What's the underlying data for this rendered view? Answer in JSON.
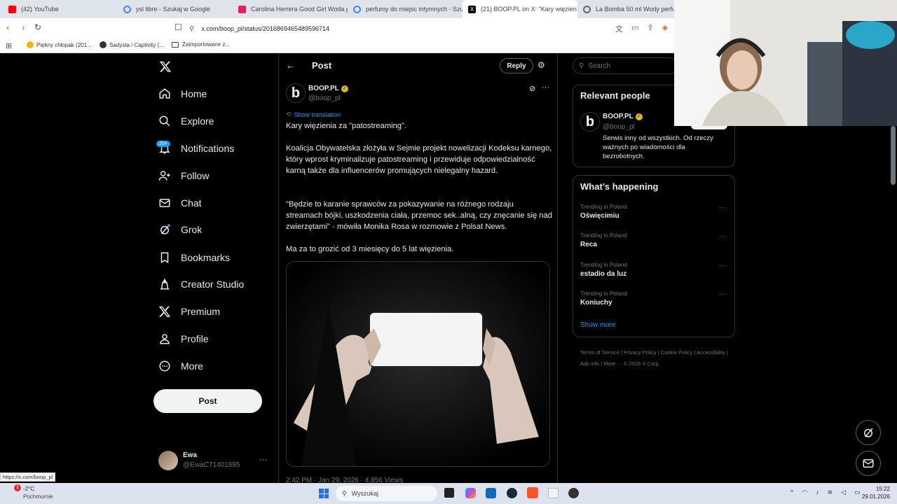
{
  "browser": {
    "tabs": [
      {
        "title": "(42) YouTube",
        "color": "#ff0000"
      },
      {
        "title": "ysl libre - Szukaj w Google",
        "color": "#4285f4"
      },
      {
        "title": "Carolina Herrera Good Girl Woda pe",
        "color": "#e0245e"
      },
      {
        "title": "perfumy do miejsc intymnych - Szuk",
        "color": "#4285f4"
      },
      {
        "title": "(21) BOOP.PL on X: \"Kary więzien",
        "color": "#000000",
        "active": true
      },
      {
        "title": "La Bomba 50 ml Wody perfumow",
        "color": "#666666"
      }
    ],
    "close": "×",
    "url": "x.com/boop_pl/status/2016869465489596714",
    "bookmarks": [
      "Piękny chłopak (201...",
      "Sadysta / Captivity (...",
      "Zaimportowane z..."
    ],
    "status_url": "https://x.com/boop_pl"
  },
  "sidebar": {
    "items": [
      {
        "label": "Home"
      },
      {
        "label": "Explore"
      },
      {
        "label": "Notifications",
        "badge": "20+"
      },
      {
        "label": "Follow"
      },
      {
        "label": "Chat"
      },
      {
        "label": "Grok"
      },
      {
        "label": "Bookmarks"
      },
      {
        "label": "Creator Studio"
      },
      {
        "label": "Premium"
      },
      {
        "label": "Profile"
      },
      {
        "label": "More"
      }
    ],
    "post_button": "Post",
    "user": {
      "name": "Ewa",
      "handle": "@EwaC71401895",
      "menu": "···"
    }
  },
  "post": {
    "header_title": "Post",
    "reply_button": "Reply",
    "author_name": "BOOP.PL",
    "author_handle": "@boop_pl",
    "show_translation": "Show translation",
    "paragraphs": [
      "Kary więzienia za \"patostreaming\".",
      "Koalicja Obywatelska złożyła w Sejmie projekt nowelizacji Kodeksu karnego, który wprost kryminalizuje patostreaming i przewiduje odpowiedzialność karną także dla influencerów promujących nielegalny hazard.",
      "\"Będzie to karanie sprawców za pokazywanie na różnego rodzaju streamach bójki, uszkodzenia ciała, przemoc sek..alną, czy znęcanie się nad zwierzętami\" - mówiła Monika Rosa w rozmowie z Polsat News.",
      "Ma za to grozić od 3 miesięcy do 5 lat więzienia."
    ],
    "meta": "2:42 PM · Jan 29, 2026 · 4,856 Views"
  },
  "right": {
    "search_placeholder": "Search",
    "relevant_title": "Relevant people",
    "person_name": "BOOP.PL",
    "person_handle": "@boop_pl",
    "person_bio": "Serwis inny od wszystkich. Od rzeczy ważnych po wiadomości dla bezrobotnych.",
    "happening_title": "What’s happening",
    "trends": [
      {
        "context": "Trending in Poland",
        "name": "Oświęcimiu"
      },
      {
        "context": "Trending in Poland",
        "name": "Reca"
      },
      {
        "context": "Trending in Poland",
        "name": "estadio da luz"
      },
      {
        "context": "Trending in Poland",
        "name": "Koniuchy"
      }
    ],
    "show_more": "Show more",
    "footer": [
      "Terms of Service",
      "Privacy Policy",
      "Cookie Policy",
      "Accessibility",
      "Ads info",
      "More ···",
      "© 2026 X Corp."
    ]
  },
  "taskbar": {
    "weather_temp": "-2°C",
    "weather_desc": "Pochmurnie",
    "weather_badge": "1",
    "search_placeholder": "Wyszukaj",
    "time": "15:22",
    "date": "29.01.2026"
  },
  "colors": {
    "accent": "#1d9bf0",
    "verified": "#e2b719"
  }
}
